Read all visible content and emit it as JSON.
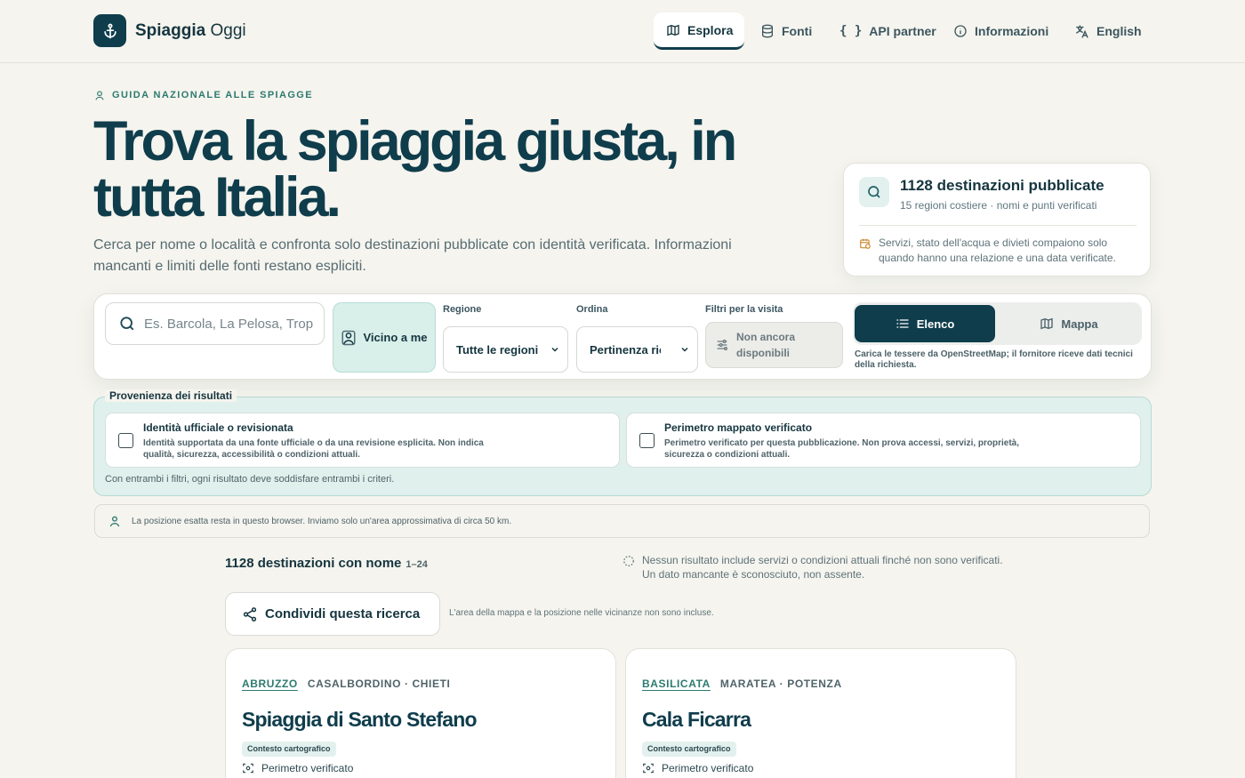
{
  "brand": {
    "name_bold": "Spiaggia",
    "name_light": "Oggi"
  },
  "nav": [
    {
      "label": "Esplora"
    },
    {
      "label": "Fonti"
    },
    {
      "label": "API partner"
    },
    {
      "label": "Informazioni"
    },
    {
      "label": "English"
    }
  ],
  "hero": {
    "kicker": "GUIDA NAZIONALE ALLE SPIAGGE",
    "title": "Trova la spiaggia giusta, in tutta Italia.",
    "subtitle": "Cerca per nome o località e confronta solo destinazioni pubblicate con identità verificata. Informazioni mancanti e limiti delle fonti restano espliciti."
  },
  "stats": {
    "title": "1128 destinazioni pubblicate",
    "subtitle": "15 regioni costiere · nomi e punti verificati",
    "note": "Servizi, stato dell'acqua e divieti compaiono solo quando hanno una relazione e una data verificate."
  },
  "search": {
    "placeholder": "Es. Barcola, La Pelosa, Tropea",
    "near_label": "Vicino a me",
    "region_label": "Regione",
    "region_value": "Tutte le regioni",
    "sort_label": "Ordina",
    "sort_value": "Pertinenza ricerca",
    "filters_label": "Filtri per la visita",
    "filters_value": "Non ancora disponibili",
    "view_list": "Elenco",
    "view_map": "Mappa",
    "view_note": "Carica le tessere da OpenStreetMap; il fornitore riceve dati tecnici della richiesta."
  },
  "provenance": {
    "legend": "Provenienza dei risultati",
    "options": [
      {
        "title": "Identità ufficiale o revisionata",
        "desc": "Identità supportata da una fonte ufficiale o da una revisione esplicita. Non indica qualità, sicurezza, accessibilità o condizioni attuali.",
        "checked": false
      },
      {
        "title": "Perimetro mappato verificato",
        "desc": "Perimetro verificato per questa pubblicazione. Non prova accessi, servizi, proprietà, sicurezza o condizioni attuali.",
        "checked": false
      }
    ],
    "footnote": "Con entrambi i filtri, ogni risultato deve soddisfare entrambi i criteri."
  },
  "location_note": "La posizione esatta resta in questo browser. Inviamo solo un'area approssimativa di circa 50 km.",
  "results": {
    "count": "1128 destinazioni con nome",
    "range": "1–24",
    "info": "Nessun risultato include servizi o condizioni attuali finché non sono verificati. Un dato mancante è sconosciuto, non assente.",
    "share_label": "Condividi questa ricerca",
    "share_note": "L'area della mappa e la posizione nelle vicinanze non sono incluse."
  },
  "cards": [
    {
      "region": "ABRUZZO",
      "place": "CASALBORDINO · CHIETI",
      "title": "Spiaggia di Santo Stefano",
      "badge": "Contesto cartografico",
      "feature": "Perimetro verificato"
    },
    {
      "region": "BASILICATA",
      "place": "MARATEA · POTENZA",
      "title": "Cala Ficarra",
      "badge": "Contesto cartografico",
      "feature": "Perimetro verificato"
    }
  ],
  "colors": {
    "primary": "#0f3d4c",
    "accent": "#2d7a70",
    "tint": "#e0f0ec",
    "background": "#f5f4ee"
  }
}
